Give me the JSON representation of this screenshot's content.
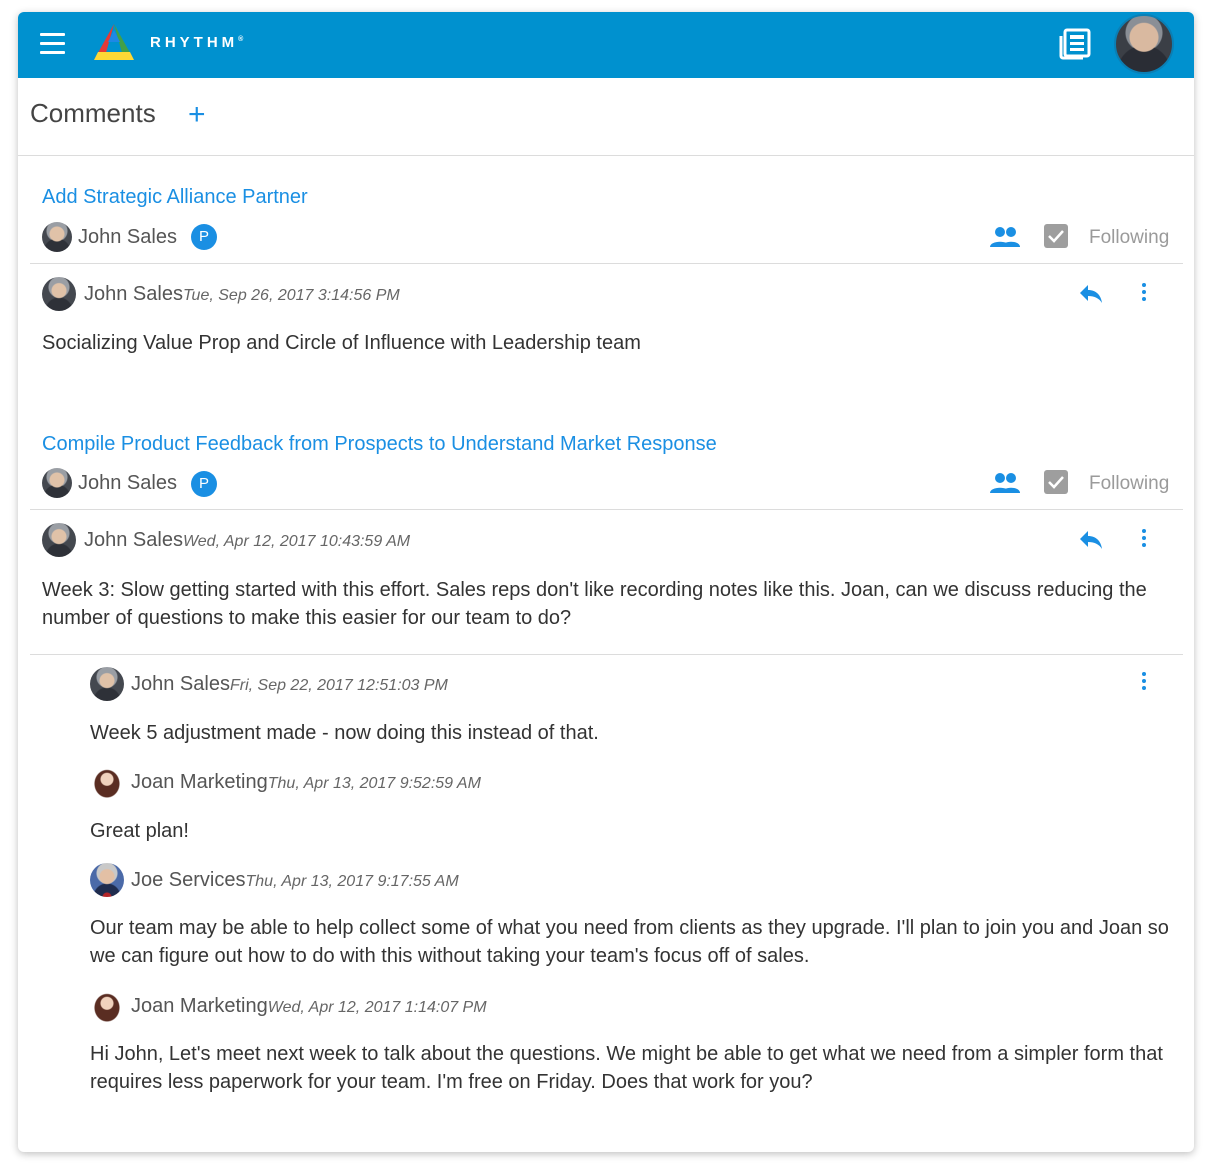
{
  "app": {
    "brand": "RHYTHM",
    "brand_mark": "®"
  },
  "header": {
    "menu_icon": "hamburger-icon",
    "news_icon": "newspaper-icon",
    "avatar": "user-avatar"
  },
  "page": {
    "title": "Comments",
    "add_label": "+"
  },
  "threads": [
    {
      "title": "Add Strategic Alliance Partner",
      "owner": "John Sales",
      "badge": "P",
      "following_label": "Following",
      "comments": [
        {
          "author": "John Sales",
          "timestamp": "Tue, Sep 26, 2017 3:14:56 PM",
          "text": "Socializing Value Prop and Circle of Influence with Leadership team"
        }
      ]
    },
    {
      "title": "Compile Product Feedback from Prospects to Understand Market Response",
      "owner": "John Sales",
      "badge": "P",
      "following_label": "Following",
      "comments": [
        {
          "author": "John Sales",
          "timestamp": "Wed, Apr 12, 2017 10:43:59 AM",
          "text": "Week 3: Slow getting started with this effort. Sales reps don't like recording notes like this. Joan, can we discuss reducing the number of questions to make this easier for our team to do?"
        }
      ],
      "replies": [
        {
          "author": "John Sales",
          "timestamp": "Fri, Sep 22, 2017 12:51:03 PM",
          "text": "Week 5 adjustment made - now doing this instead of that."
        },
        {
          "author": "Joan Marketing",
          "timestamp": "Thu, Apr 13, 2017 9:52:59 AM",
          "text": "Great plan!"
        },
        {
          "author": "Joe Services",
          "timestamp": "Thu, Apr 13, 2017 9:17:55 AM",
          "text": "Our team may be able to help collect some of what you need from clients as they upgrade. I'll plan to join you and Joan so we can figure out how to do with this without taking your team's focus off of sales."
        },
        {
          "author": "Joan Marketing",
          "timestamp": "Wed, Apr 12, 2017 1:14:07 PM",
          "text": "Hi John, Let's meet next week to talk about the questions. We might be able to get what we need from a simpler form that requires less paperwork for your team. I'm free on Friday. Does that work for you?"
        }
      ]
    }
  ],
  "colors": {
    "header_bg": "#0091cf",
    "link": "#1a8fe3",
    "checkbox": "#9e9e9e"
  }
}
